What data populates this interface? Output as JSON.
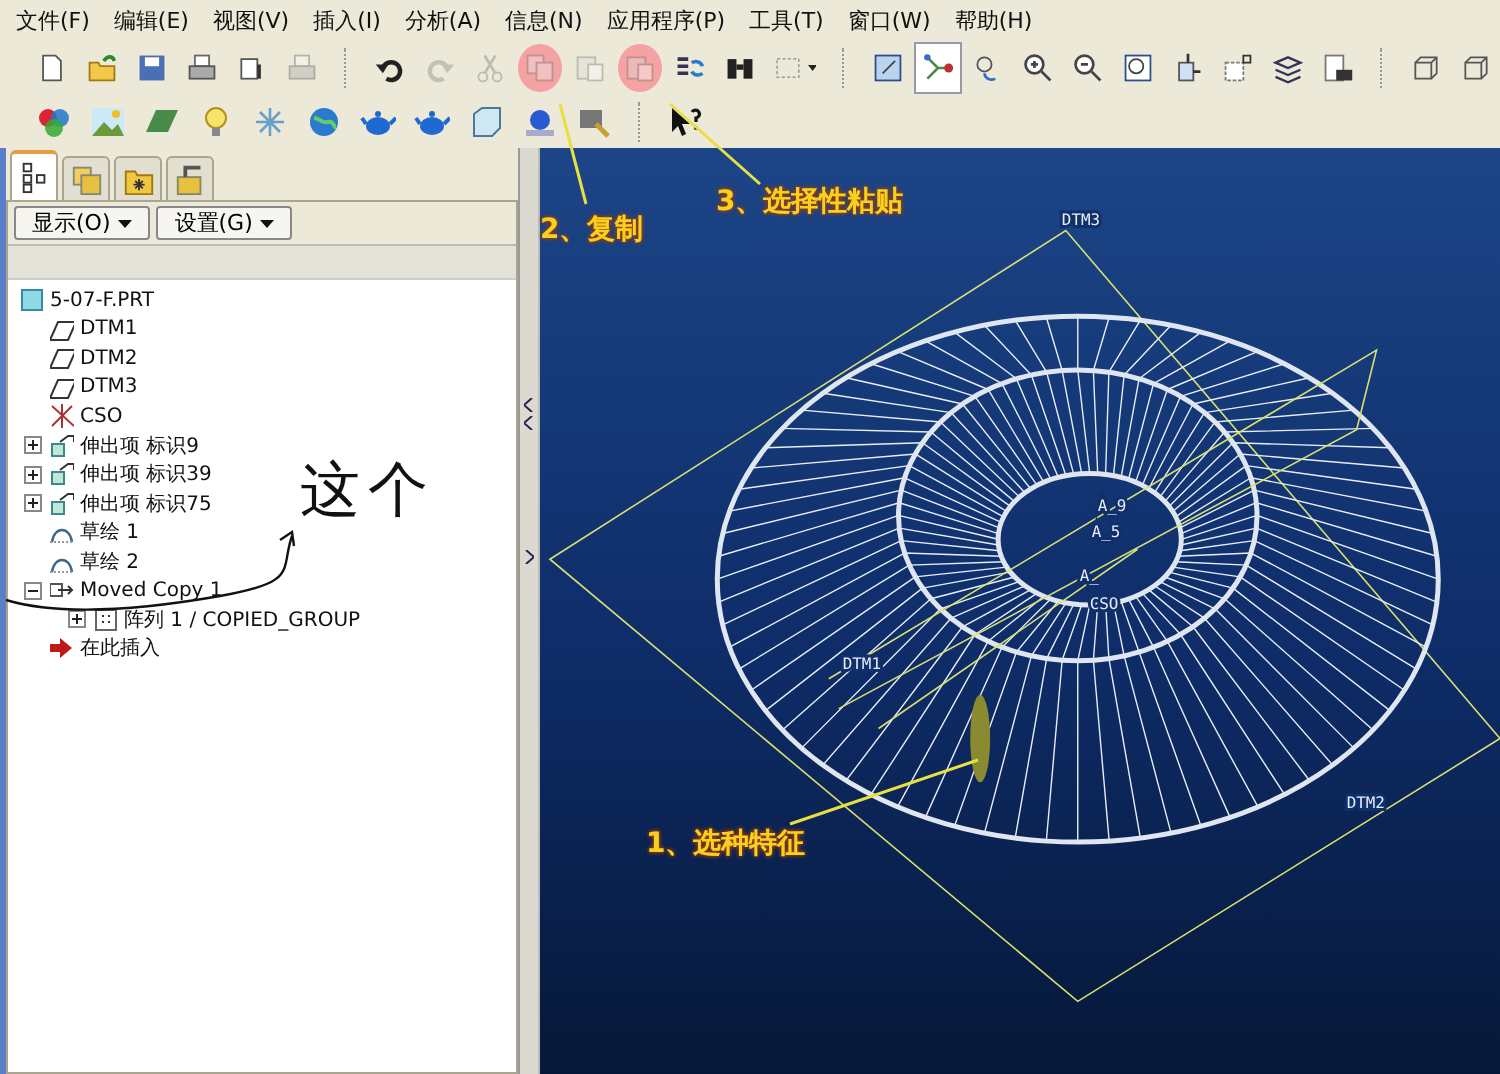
{
  "menu": [
    "文件(F)",
    "编辑(E)",
    "视图(V)",
    "插入(I)",
    "分析(A)",
    "信息(N)",
    "应用程序(P)",
    "工具(T)",
    "窗口(W)",
    "帮助(H)"
  ],
  "toolbar": {
    "row1": [
      {
        "kind": "new",
        "disabled": false,
        "highlighted": false,
        "pressed": false
      },
      {
        "kind": "open",
        "disabled": false,
        "highlighted": false,
        "pressed": false
      },
      {
        "kind": "save",
        "disabled": false,
        "highlighted": false,
        "pressed": false
      },
      {
        "kind": "print",
        "disabled": false,
        "highlighted": false,
        "pressed": false
      },
      {
        "kind": "attach",
        "disabled": false,
        "highlighted": false,
        "pressed": false
      },
      {
        "kind": "print",
        "disabled": true,
        "highlighted": false,
        "pressed": false
      },
      {
        "kind": "sep",
        "disabled": false,
        "highlighted": false,
        "pressed": false
      },
      {
        "kind": "undo",
        "disabled": false,
        "highlighted": false,
        "pressed": false
      },
      {
        "kind": "redo",
        "disabled": true,
        "highlighted": false,
        "pressed": false
      },
      {
        "kind": "cut",
        "disabled": true,
        "highlighted": false,
        "pressed": false
      },
      {
        "kind": "copy",
        "disabled": true,
        "highlighted": true,
        "pressed": false
      },
      {
        "kind": "paste",
        "disabled": true,
        "highlighted": false,
        "pressed": false
      },
      {
        "kind": "paste",
        "disabled": true,
        "highlighted": true,
        "pressed": false
      },
      {
        "kind": "regen",
        "disabled": false,
        "highlighted": false,
        "pressed": false
      },
      {
        "kind": "find",
        "disabled": false,
        "highlighted": false,
        "pressed": false
      },
      {
        "kind": "select",
        "disabled": false,
        "highlighted": false,
        "pressed": false
      },
      {
        "kind": "sep",
        "disabled": false,
        "highlighted": false,
        "pressed": false
      },
      {
        "kind": "repaint",
        "disabled": false,
        "highlighted": false,
        "pressed": false
      },
      {
        "kind": "spin",
        "disabled": false,
        "highlighted": false,
        "pressed": true
      },
      {
        "kind": "orient",
        "disabled": false,
        "highlighted": false,
        "pressed": false
      },
      {
        "kind": "zoomin",
        "disabled": false,
        "highlighted": false,
        "pressed": false
      },
      {
        "kind": "zoomout",
        "disabled": false,
        "highlighted": false,
        "pressed": false
      },
      {
        "kind": "fit",
        "disabled": false,
        "highlighted": false,
        "pressed": false
      },
      {
        "kind": "cubearrow",
        "disabled": false,
        "highlighted": false,
        "pressed": false
      },
      {
        "kind": "label",
        "disabled": false,
        "highlighted": false,
        "pressed": false
      },
      {
        "kind": "layers",
        "disabled": false,
        "highlighted": false,
        "pressed": false
      },
      {
        "kind": "camera",
        "disabled": false,
        "highlighted": false,
        "pressed": false
      },
      {
        "kind": "sep",
        "disabled": false,
        "highlighted": false,
        "pressed": false
      },
      {
        "kind": "box",
        "disabled": false,
        "highlighted": false,
        "pressed": false
      },
      {
        "kind": "box",
        "disabled": false,
        "highlighted": false,
        "pressed": false
      }
    ],
    "row2": [
      {
        "kind": "colorwheel"
      },
      {
        "kind": "landscape"
      },
      {
        "kind": "terrain"
      },
      {
        "kind": "bulb"
      },
      {
        "kind": "spark"
      },
      {
        "kind": "globe"
      },
      {
        "kind": "teapot"
      },
      {
        "kind": "teapot"
      },
      {
        "kind": "cube"
      },
      {
        "kind": "sphere"
      },
      {
        "kind": "brush"
      },
      {
        "kind": "sep"
      },
      {
        "kind": "help"
      }
    ]
  },
  "panel": {
    "tabs": [
      {
        "kind": "tree",
        "selected": true
      },
      {
        "kind": "layers",
        "selected": false
      },
      {
        "kind": "folder",
        "selected": false
      },
      {
        "kind": "tools",
        "selected": false
      }
    ],
    "buttons": [
      "显示(O)",
      "设置(G)"
    ],
    "tree": [
      {
        "label": "5-07-F.PRT",
        "kind": "part",
        "children": [
          {
            "label": "DTM1",
            "kind": "plane"
          },
          {
            "label": "DTM2",
            "kind": "plane"
          },
          {
            "label": "DTM3",
            "kind": "plane"
          },
          {
            "label": "CSO",
            "kind": "csys"
          },
          {
            "label": "伸出项 标识9",
            "kind": "extrude",
            "expanded": false
          },
          {
            "label": "伸出项 标识39",
            "kind": "extrude",
            "expanded": false
          },
          {
            "label": "伸出项 标识75",
            "kind": "extrude",
            "expanded": false
          },
          {
            "label": "草绘 1",
            "kind": "sketch"
          },
          {
            "label": "草绘 2",
            "kind": "sketch"
          },
          {
            "label": "Moved Copy 1",
            "kind": "group",
            "expanded": true,
            "children": [
              {
                "label": "阵列 1 / COPIED_GROUP",
                "kind": "pattern",
                "expanded": false
              }
            ]
          },
          {
            "label": "在此插入",
            "kind": "insert"
          }
        ]
      }
    ]
  },
  "viewport": {
    "labels": [
      "DTM3",
      "A_9",
      "A_5",
      "A_",
      "CSO",
      "DTM1",
      "DTM2"
    ]
  },
  "annotations": [
    {
      "text": "2、复制"
    },
    {
      "text": "3、选择性粘贴"
    },
    {
      "text": "1、选种特征"
    },
    {
      "text": "这个"
    }
  ]
}
